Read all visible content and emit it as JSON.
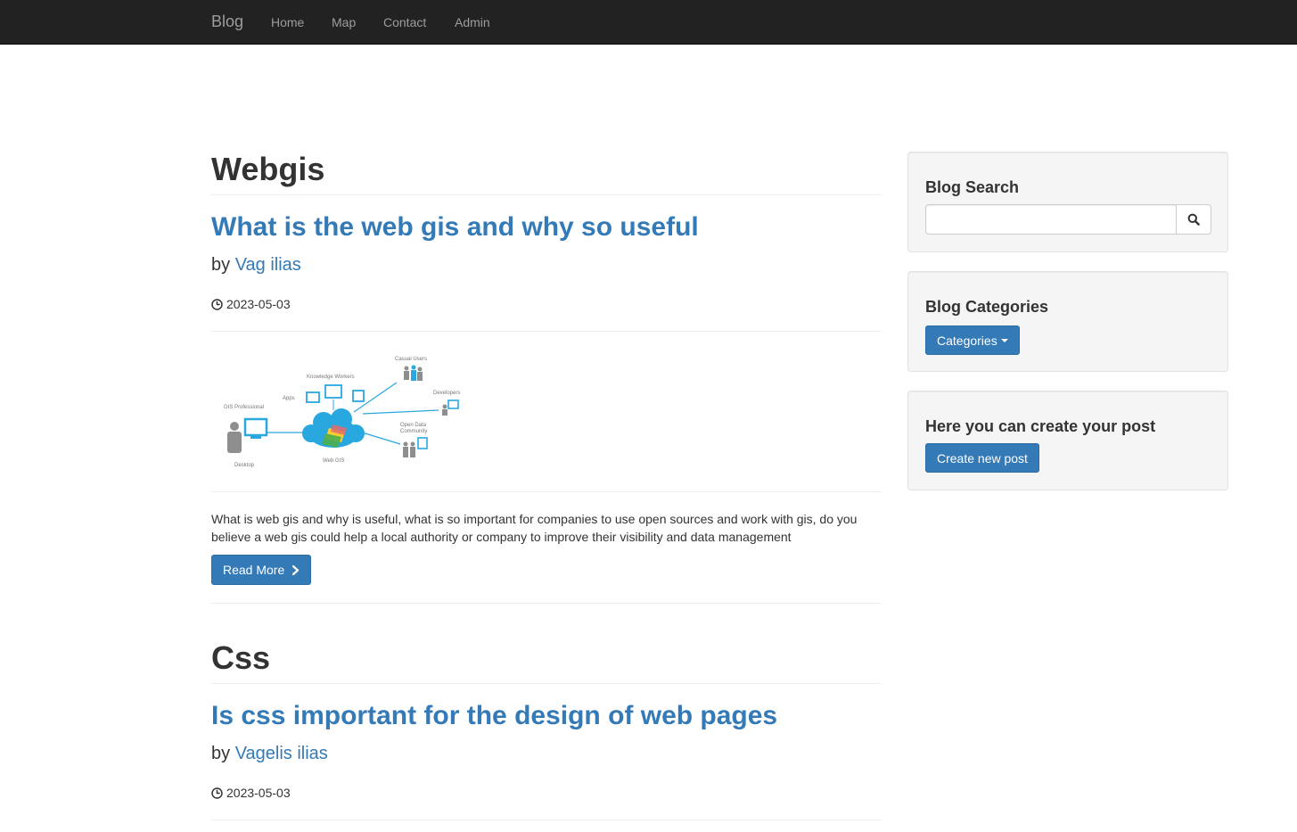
{
  "navbar": {
    "brand": "Blog",
    "links": [
      "Home",
      "Map",
      "Contact",
      "Admin"
    ]
  },
  "posts": [
    {
      "category": "Webgis",
      "title": "What is the web gis and why so useful",
      "by_label": "by",
      "author": "Vag ilias",
      "date": "2023-05-03",
      "image": {
        "labels": [
          "GIS Professional",
          "Desktop",
          "Apps",
          "Knowledge Workers",
          "Casual Users",
          "Developers",
          "Open Data",
          "Community",
          "Web GIS"
        ]
      },
      "excerpt": "What is web gis and why is useful, what is so important for companies to use open sources and work with gis, do you believe a web gis could help a local authority or company to improve their visibility and data management",
      "read_more": "Read More"
    },
    {
      "category": "Css",
      "title": "Is css important for the design of web pages",
      "by_label": "by",
      "author": "Vagelis ilias",
      "date": "2023-05-03"
    }
  ],
  "sidebar": {
    "search": {
      "title": "Blog Search",
      "placeholder": "",
      "value": ""
    },
    "categories": {
      "title": "Blog Categories",
      "button": "Categories"
    },
    "create": {
      "title": "Here you can create your post",
      "button": "Create new post"
    }
  },
  "colors": {
    "navbar_bg": "#222222",
    "link": "#337ab7",
    "primary_button": "#337ab7",
    "well_bg": "#f5f5f5"
  }
}
